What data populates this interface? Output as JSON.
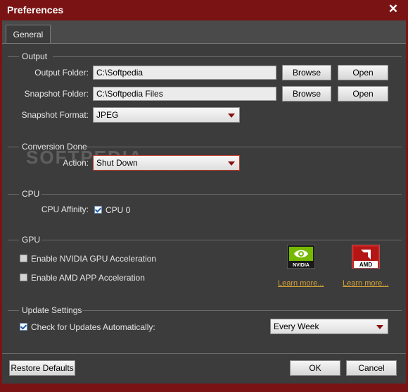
{
  "window": {
    "title": "Preferences",
    "close_glyph": "✕"
  },
  "tabs": [
    {
      "label": "General"
    }
  ],
  "output": {
    "section_label": "Output",
    "output_folder_label": "Output Folder:",
    "output_folder_value": "C:\\Softpedia",
    "snapshot_folder_label": "Snapshot Folder:",
    "snapshot_folder_value": "C:\\Softpedia Files",
    "snapshot_format_label": "Snapshot Format:",
    "snapshot_format_value": "JPEG",
    "browse_label": "Browse",
    "open_label": "Open"
  },
  "conversion": {
    "section_label": "Conversion Done",
    "action_label": "Action:",
    "action_value": "Shut Down"
  },
  "cpu": {
    "section_label": "CPU",
    "affinity_label": "CPU Affinity:",
    "cpu0_label": "CPU 0",
    "cpu0_checked": true
  },
  "gpu": {
    "section_label": "GPU",
    "nvidia_label": "Enable NVIDIA GPU Acceleration",
    "nvidia_checked": false,
    "amd_label": "Enable AMD APP Acceleration",
    "amd_checked": false,
    "nvidia_logo_text": "NVIDIA",
    "amd_logo_text": "AMD",
    "learn_more": "Learn more..."
  },
  "update": {
    "section_label": "Update Settings",
    "check_label": "Check for Updates Automatically:",
    "check_checked": true,
    "frequency_value": "Every Week"
  },
  "footer": {
    "restore_label": "Restore Defaults",
    "ok_label": "OK",
    "cancel_label": "Cancel"
  },
  "watermark": "SOFTPEDIA",
  "colors": {
    "frame": "#7a1414",
    "panel": "#3c3c3c",
    "link": "#d6a236",
    "nvidia": "#76b900",
    "amd": "#c8201e"
  }
}
